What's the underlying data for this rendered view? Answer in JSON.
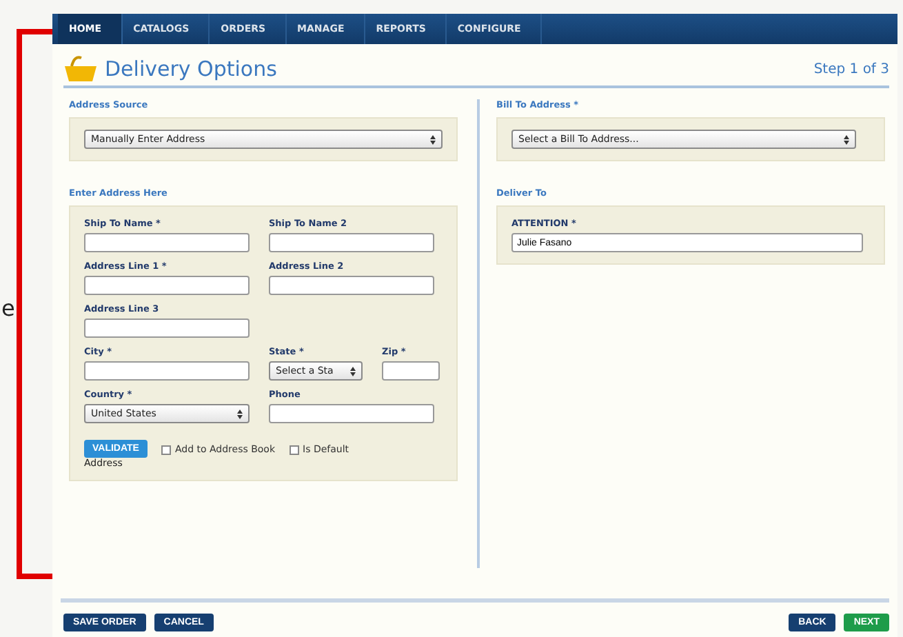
{
  "annotation": {
    "side_text": "e"
  },
  "nav": [
    {
      "label": "HOME",
      "selected": true
    },
    {
      "label": "CATALOGS",
      "selected": false
    },
    {
      "label": "ORDERS",
      "selected": false
    },
    {
      "label": "MANAGE",
      "selected": false
    },
    {
      "label": "REPORTS",
      "selected": false
    },
    {
      "label": "CONFIGURE",
      "selected": false
    }
  ],
  "header": {
    "title": "Delivery Options",
    "step": "Step 1 of 3"
  },
  "address_source": {
    "label": "Address Source",
    "value": "Manually Enter Address"
  },
  "enter_address": {
    "label": "Enter Address Here",
    "rows": [
      [
        {
          "kind": "input",
          "label": "Ship To Name *"
        },
        {
          "kind": "input",
          "label": "Ship To Name 2"
        }
      ],
      [
        {
          "kind": "input",
          "label": "Address Line 1 *"
        },
        {
          "kind": "input",
          "label": "Address Line 2"
        }
      ],
      [
        {
          "kind": "input",
          "label": "Address Line 3"
        }
      ],
      [
        {
          "kind": "input",
          "label": "City *"
        },
        {
          "kind": "select",
          "label": "State *",
          "value": "Select a Sta"
        },
        {
          "kind": "input",
          "label": "Zip *"
        }
      ],
      [
        {
          "kind": "select",
          "label": "Country *",
          "value": "United States"
        },
        {
          "kind": "input",
          "label": "Phone"
        }
      ]
    ],
    "validate_button": "VALIDATE",
    "validate_caption": "Address",
    "checkboxes": [
      {
        "label": "Add to Address Book",
        "checked": false
      },
      {
        "label": "Is Default",
        "checked": false
      }
    ]
  },
  "bill_to": {
    "label": "Bill To Address *",
    "value": "Select a Bill To Address..."
  },
  "deliver_to": {
    "label": "Deliver To",
    "field_label": "ATTENTION *",
    "value": "Julie Fasano"
  },
  "footer": {
    "left_buttons": [
      "SAVE ORDER",
      "CANCEL"
    ],
    "right_buttons": [
      {
        "label": "BACK",
        "kind": "back"
      },
      {
        "label": "NEXT",
        "kind": "next"
      }
    ]
  }
}
